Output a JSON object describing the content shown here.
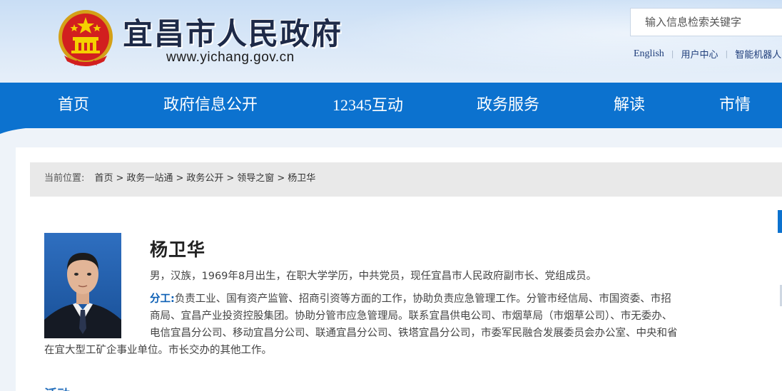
{
  "header": {
    "site_title": "宜昌市人民政府",
    "site_url": "www.yichang.gov.cn",
    "search_placeholder": "输入信息检索关键字",
    "links": [
      "English",
      "用户中心",
      "智能机器人"
    ]
  },
  "nav": {
    "items": [
      "首页",
      "政府信息公开",
      "12345互动",
      "政务服务",
      "解读",
      "市情"
    ]
  },
  "breadcrumb": {
    "here_label": "当前位置:",
    "items": [
      "首页",
      "政务一站通",
      "政务公开",
      "领导之窗",
      "杨卫华"
    ],
    "separator": ">"
  },
  "profile": {
    "name": "杨卫华",
    "intro": "男，汉族，1969年8月出生，在职大学学历，中共党员，现任宜昌市人民政府副市长、党组成员。",
    "duty_label": "分工:",
    "duty_lines": [
      "负责工业、国有资产监管、招商引资等方面的工作，协助负责应急管理工作。分管市经信局、市国资委、市招",
      "商局、宜昌产业投资控股集团。协助分管市应急管理局。联系宜昌供电公司、市烟草局（市烟草公司）、市无委办、",
      "电信宜昌分公司、移动宜昌分公司、联通宜昌分公司、铁塔宜昌分公司，市委军民融合发展委员会办公室、中央和省",
      "在宜大型工矿企事业单位。市长交办的其他工作。"
    ],
    "next_heading": "活动"
  },
  "colors": {
    "nav_bg": "#0c72cf",
    "header_bg": "#c9def5",
    "accent_text": "#0c5fb5",
    "breadcrumb_bg": "#e9e9e9"
  }
}
